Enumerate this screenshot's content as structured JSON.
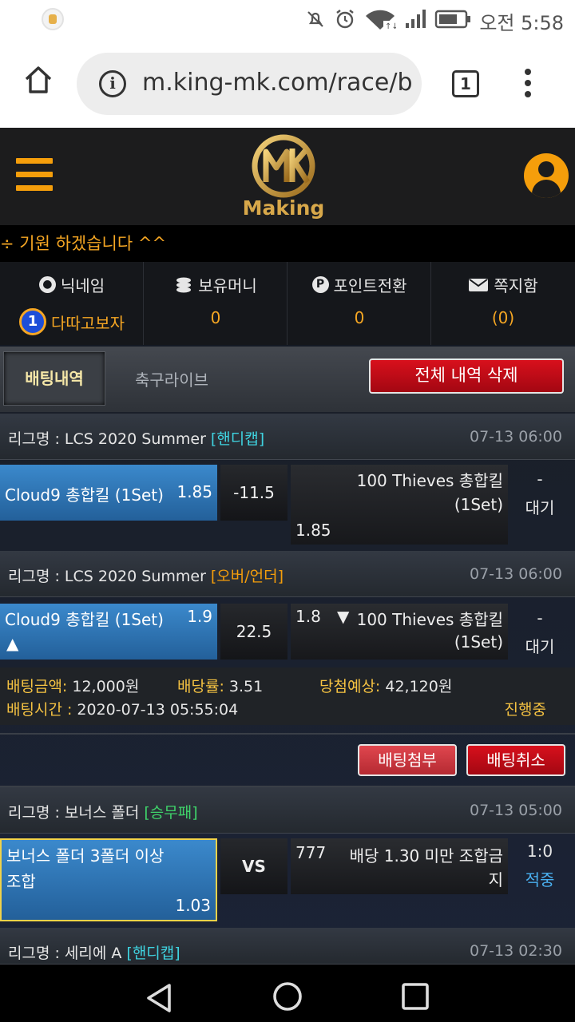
{
  "status_bar": {
    "time": "오전 5:58",
    "icons": [
      "notification-muted-icon",
      "alarm-icon",
      "wifi-icon",
      "signal-icon",
      "battery-icon"
    ]
  },
  "browser": {
    "url": "m.king-mk.com/race/b",
    "tab_count": "1"
  },
  "site": {
    "logo_text": "Making",
    "accent": "#f59e0b"
  },
  "ticker": {
    "text": "÷ 기원 하겠습니다 ^^"
  },
  "info": {
    "nickname_label": "닉네임",
    "nickname_value": "다따고보자",
    "rank": "1",
    "money_label": "보유머니",
    "money_value": "0",
    "point_label": "포인트전환",
    "point_value": "0",
    "message_label": "쪽지함",
    "message_value": "(0)"
  },
  "tabs": {
    "betting_history": "배팅내역",
    "soccer_live": "축구라이브",
    "delete_all": "전체 내역 삭제"
  },
  "bets": [
    {
      "league_prefix": "리그명 : LCS 2020 Summer",
      "tag": "[핸디캡]",
      "date": "07-13 06:00",
      "home_name": "Cloud9 총합킬 (1Set)",
      "home_odds": "1.85",
      "middle": "-11.5",
      "away_name_1": "100 Thieves 총합킬",
      "away_name_2": "(1Set)",
      "away_odds": "1.85",
      "status_1": "-",
      "status_2": "대기"
    },
    {
      "league_prefix": "리그명 : LCS 2020 Summer",
      "tag": "[오버/언더]",
      "date": "07-13 06:00",
      "home_name": "Cloud9 총합킬 (1Set)",
      "home_odds": "1.9",
      "home_arrow": "▲",
      "middle": "22.5",
      "away_odds": "1.8",
      "away_arrow": "▼",
      "away_name_1": "100 Thieves 총합킬",
      "away_name_2": "(1Set)",
      "status_1": "-",
      "status_2": "대기"
    }
  ],
  "summary": {
    "amount_label": "배팅금액:",
    "amount_value": "12,000원",
    "rate_label": "배당률:",
    "rate_value": "3.51",
    "expected_label": "당첨예상:",
    "expected_value": "42,120원",
    "time_label": "배팅시간 :",
    "time_value": "2020-07-13 05:55:04",
    "progress": "진행중"
  },
  "actions": {
    "attach": "배팅첨부",
    "cancel": "배팅취소"
  },
  "bet3": {
    "league_prefix": "리그명 : 보너스 폴더",
    "tag": "[승무패]",
    "date": "07-13 05:00",
    "home_name_1": "보너스 폴더 3폴더 이상",
    "home_name_2": "조합",
    "home_odds": "1.03",
    "middle": "VS",
    "away_odds": "777",
    "away_name_1": "배당 1.30 미만 조합금",
    "away_name_2": "지",
    "score": "1:0",
    "result": "적중"
  },
  "bet4": {
    "league_prefix": "리그명 : 세리에 A",
    "tag": "[핸디캡]",
    "date": "07-13 02:30"
  }
}
